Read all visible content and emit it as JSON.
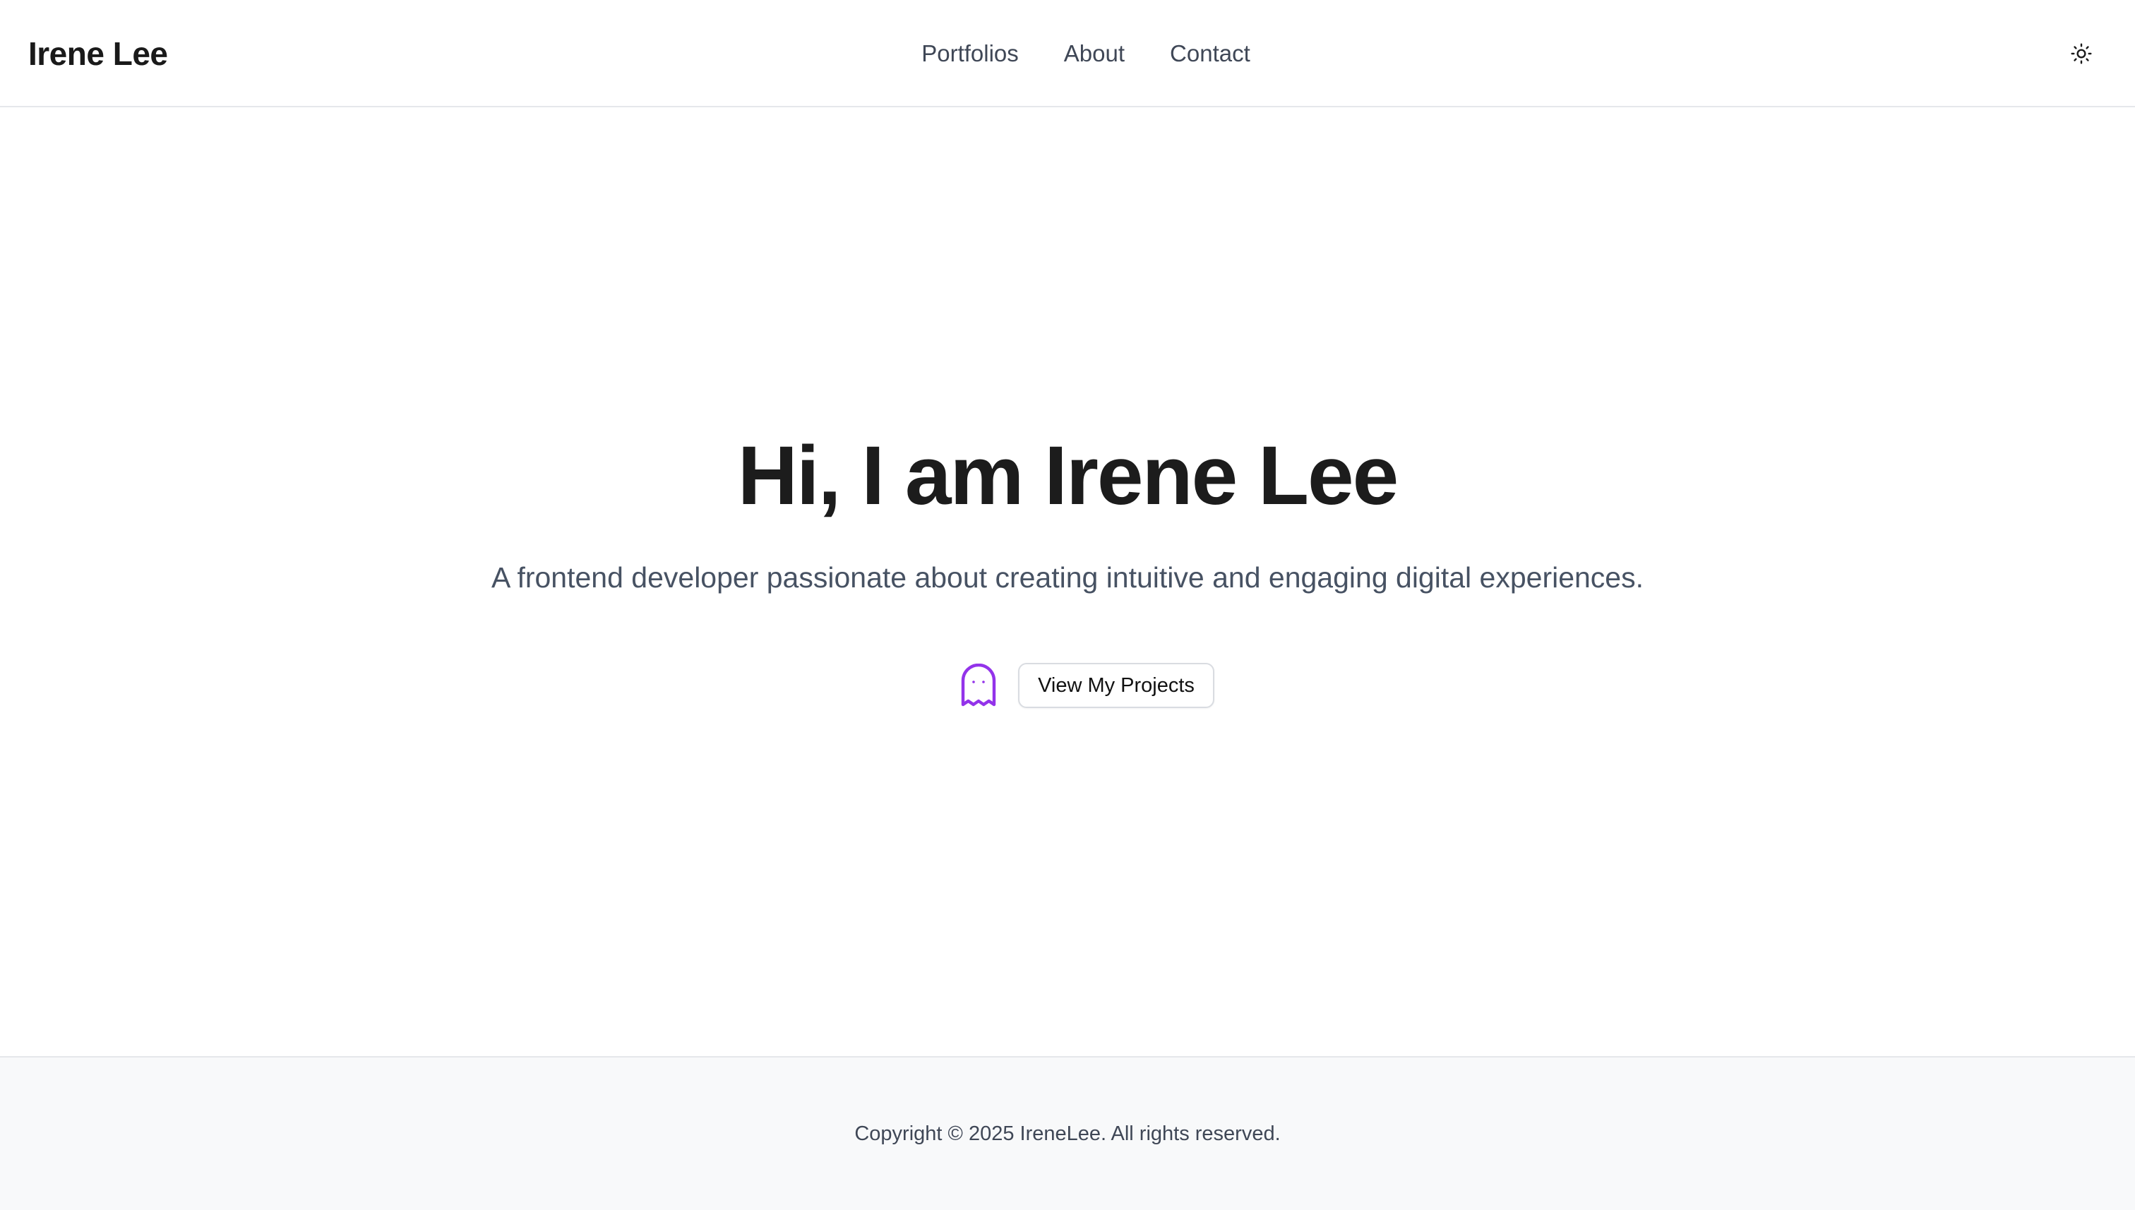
{
  "header": {
    "brand": "Irene Lee",
    "nav": [
      {
        "label": "Portfolios"
      },
      {
        "label": "About"
      },
      {
        "label": "Contact"
      }
    ],
    "theme_toggle_icon": "sun-icon"
  },
  "hero": {
    "title": "Hi, I am Irene Lee",
    "subtitle": "A frontend developer passionate about creating intuitive and engaging digital experiences.",
    "icon": "ghost-icon",
    "icon_color": "#9333ea",
    "cta_label": "View My Projects"
  },
  "footer": {
    "copyright": "Copyright © 2025 IreneLee. All rights reserved."
  }
}
